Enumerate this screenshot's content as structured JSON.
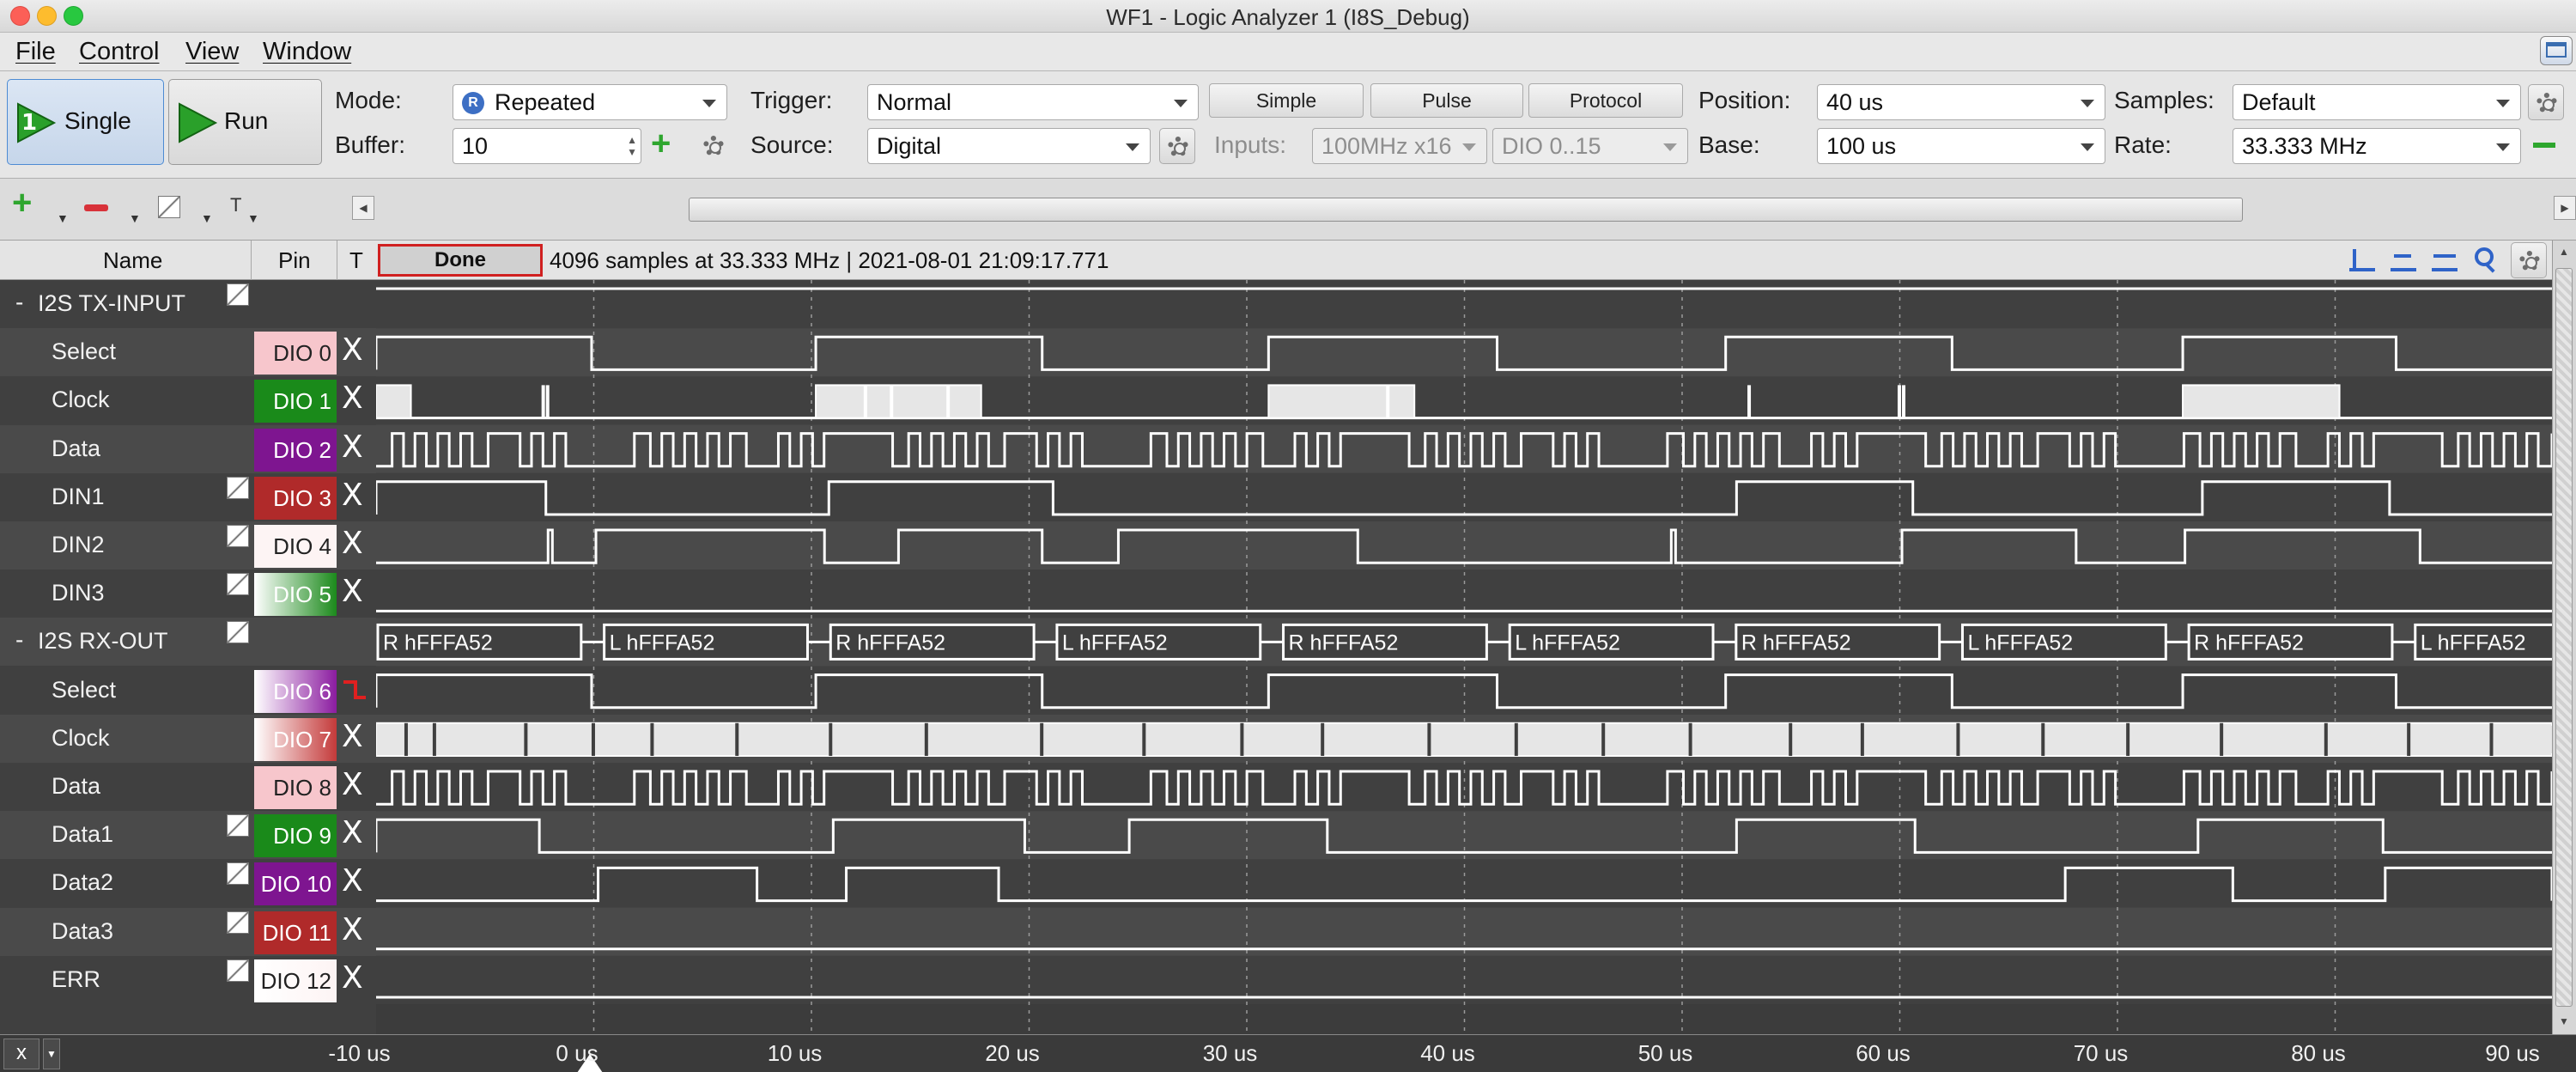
{
  "window": {
    "title": "WF1 - Logic Analyzer 1 (I8S_Debug)"
  },
  "menu": [
    "File",
    "Control",
    "View",
    "Window"
  ],
  "toolbar": {
    "single_label": "Single",
    "single_badge": "1",
    "run_label": "Run",
    "mode_label": "Mode:",
    "mode_value": "Repeated",
    "mode_badge": "R",
    "buffer_label": "Buffer:",
    "buffer_value": "10",
    "trigger_label": "Trigger:",
    "trigger_value": "Normal",
    "source_label": "Source:",
    "source_value": "Digital",
    "trigger_tabs": [
      "Simple",
      "Pulse",
      "Protocol"
    ],
    "inputs_label": "Inputs:",
    "inputs_rate": "100MHz x16",
    "inputs_channels": "DIO 0..15",
    "position_label": "Position:",
    "position_value": "40 us",
    "base_label": "Base:",
    "base_value": "100 us",
    "samples_label": "Samples:",
    "samples_value": "Default",
    "rate_label": "Rate:",
    "rate_value": "33.333 MHz",
    "text_tool": "T"
  },
  "header": {
    "name": "Name",
    "pin": "Pin",
    "t": "T",
    "status": "Done",
    "info": "4096 samples at 33.333 MHz | 2021-08-01 21:09:17.771"
  },
  "channels": [
    {
      "name": "I2S TX-INPUT",
      "group": true,
      "collapse": "-"
    },
    {
      "name": "Select",
      "pin": "DIO  0",
      "trigger": "X"
    },
    {
      "name": "Clock",
      "pin": "DIO  1",
      "trigger": "X"
    },
    {
      "name": "Data",
      "pin": "DIO  2",
      "trigger": "X"
    },
    {
      "name": "DIN1",
      "pin": "DIO  3",
      "trigger": "X"
    },
    {
      "name": "DIN2",
      "pin": "DIO  4",
      "trigger": "X"
    },
    {
      "name": "DIN3",
      "pin": "DIO  5",
      "trigger": "X"
    },
    {
      "name": "I2S RX-OUT",
      "group": true,
      "collapse": "-"
    },
    {
      "name": "Select",
      "pin": "DIO  6",
      "trigger": ""
    },
    {
      "name": "Clock",
      "pin": "DIO  7",
      "trigger": "X"
    },
    {
      "name": "Data",
      "pin": "DIO  8",
      "trigger": "X"
    },
    {
      "name": "Data1",
      "pin": "DIO  9",
      "trigger": "X"
    },
    {
      "name": "Data2",
      "pin": "DIO 10",
      "trigger": "X"
    },
    {
      "name": "Data3",
      "pin": "DIO 11",
      "trigger": "X"
    },
    {
      "name": "ERR",
      "pin": "DIO 12",
      "trigger": "X"
    }
  ],
  "pin_colors": {
    "DIO 0": "#f7c6cc",
    "DIO 1": "#1a8a1a",
    "DIO 2": "#7e1590",
    "DIO 3": "#b02a2a",
    "DIO 4": "#fdf4f4",
    "DIO 5": "#1c8a1c",
    "DIO 6": "#8b1ca0",
    "DIO 7": "#c43a3a",
    "DIO 8": "#f7c6cc",
    "DIO 9": "#1a8a1a",
    "DIO 10": "#7e1590",
    "DIO 11": "#b02a2a",
    "DIO 12": "#fdf4f4"
  },
  "bus_labels": [
    "R hFFFA52",
    "L hFFFA52",
    "R hFFFA52",
    "L hFFFA52",
    "R hFFFA52",
    "L hFFFA52",
    "R hFFFA52",
    "L hFFFA52",
    "R hFFFA52",
    "L hFFFA52"
  ],
  "axis": {
    "ticks": [
      "-10 us",
      "0 us",
      "10 us",
      "20 us",
      "30 us",
      "40 us",
      "50 us",
      "60 us",
      "70 us",
      "80 us",
      "90 us"
    ],
    "x_button": "x"
  },
  "colors": {
    "background": "#3c3c3c",
    "row_alt": "#484848",
    "trace": "#ffffff",
    "clock_fill": "#e6e6e6",
    "status_border": "#d02020",
    "trigger_edge": "#e02020",
    "add_green": "#2ea62e"
  },
  "trace_data": {
    "tx_select_high": [
      [
        -10,
        -0.1
      ],
      [
        10.2,
        20.6
      ],
      [
        31,
        41.5
      ],
      [
        52,
        62.4
      ],
      [
        73,
        82.8
      ]
    ],
    "tx_clock_dense": [
      [
        -10,
        -8.4
      ],
      [
        10.2,
        17.8
      ],
      [
        31,
        37.7
      ],
      [
        73,
        80.2
      ]
    ],
    "tx_clock_pulses": [
      -2.4,
      -2.2,
      12.4,
      13.6,
      16.2,
      36.4,
      53,
      59.9,
      60.1
    ],
    "din1_high": [
      [
        -10,
        -2.2
      ],
      [
        10.8,
        21.1
      ],
      [
        52.5,
        60.6
      ],
      [
        73.9,
        82.5
      ]
    ],
    "din2_high": [
      [
        -2.1,
        -1.9
      ],
      [
        0.1,
        10.6
      ],
      [
        14,
        20.6
      ],
      [
        24.1,
        35.1
      ],
      [
        49.5,
        49.7
      ],
      [
        60.1,
        68.1
      ],
      [
        73.1,
        83.9
      ]
    ],
    "rx_select_high": [
      [
        -10,
        -0.1
      ],
      [
        10.2,
        20.6
      ],
      [
        31,
        41.5
      ],
      [
        52,
        62.4
      ],
      [
        73,
        82.8
      ]
    ],
    "rx_data1_high": [
      [
        -10,
        -2.5
      ],
      [
        11,
        19.8
      ],
      [
        24.6,
        33.7
      ],
      [
        52.5,
        60.7
      ],
      [
        73.7,
        82.2
      ]
    ],
    "rx_data2_high": [
      [
        0.2,
        7.5
      ],
      [
        11.6,
        18.6
      ],
      [
        67.6,
        75.3
      ],
      [
        82.3,
        91
      ]
    ]
  }
}
